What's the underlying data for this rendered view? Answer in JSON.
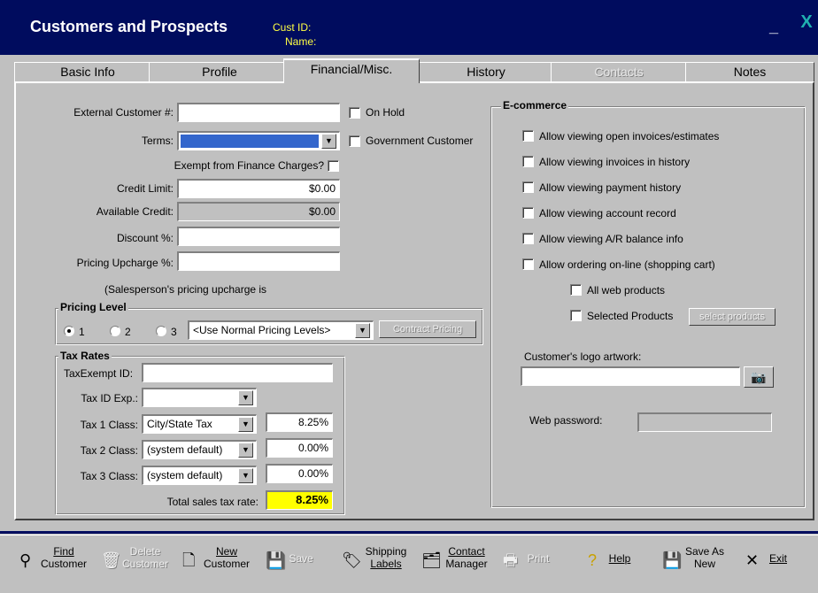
{
  "window": {
    "title": "Customers and Prospects",
    "cust_id_label": "Cust ID:",
    "name_label": "Name:",
    "minimize": "_",
    "close": "X"
  },
  "tabs": [
    {
      "label": "Basic Info",
      "state": "normal"
    },
    {
      "label": "Profile",
      "state": "normal"
    },
    {
      "label": "Financial/Misc.",
      "state": "active"
    },
    {
      "label": "History",
      "state": "normal"
    },
    {
      "label": "Contacts",
      "state": "disabled"
    },
    {
      "label": "Notes",
      "state": "normal"
    }
  ],
  "financial": {
    "external_customer_label": "External Customer #:",
    "external_customer_value": "",
    "on_hold_label": "On Hold",
    "terms_label": "Terms:",
    "terms_value": "",
    "government_label": "Government Customer",
    "exempt_label": "Exempt from Finance Charges?",
    "credit_limit_label": "Credit Limit:",
    "credit_limit_value": "$0.00",
    "available_credit_label": "Available Credit:",
    "available_credit_value": "$0.00",
    "discount_label": "Discount %:",
    "discount_value": "",
    "pricing_upcharge_label": "Pricing Upcharge %:",
    "pricing_upcharge_value": "",
    "salesperson_note": "(Salesperson's pricing upcharge is"
  },
  "pricing_level": {
    "title": "Pricing Level",
    "options": [
      "1",
      "2",
      "3"
    ],
    "selected": "1",
    "dropdown_value": "<Use Normal Pricing Levels>",
    "contract_button": "Contract Pricing"
  },
  "tax_rates": {
    "title": "Tax Rates",
    "tax_exempt_label": "TaxExempt ID:",
    "tax_exempt_value": "",
    "tax_id_exp_label": "Tax ID Exp.:",
    "tax_id_exp_value": "",
    "classes": [
      {
        "label": "Tax 1 Class:",
        "value": "City/State Tax",
        "rate": "8.25%"
      },
      {
        "label": "Tax 2 Class:",
        "value": "(system default)",
        "rate": "0.00%"
      },
      {
        "label": "Tax 3 Class:",
        "value": "(system default)",
        "rate": "0.00%"
      }
    ],
    "total_label": "Total sales tax rate:",
    "total_value": "8.25%"
  },
  "ecommerce": {
    "title": "E-commerce",
    "options": [
      "Allow viewing open invoices/estimates",
      "Allow viewing invoices in history",
      "Allow viewing payment history",
      "Allow viewing account record",
      "Allow viewing A/R balance info",
      "Allow ordering on-line (shopping cart)"
    ],
    "all_web_products": "All web products",
    "selected_products": "Selected Products",
    "select_products_button": "select products",
    "logo_label": "Customer's logo artwork:",
    "logo_value": "",
    "web_password_label": "Web password:",
    "web_password_value": ""
  },
  "toolbar": {
    "find": [
      "Find",
      "Customer"
    ],
    "delete": [
      "Delete",
      "Customer"
    ],
    "new": [
      "New",
      "Customer"
    ],
    "save": "Save",
    "shipping": [
      "Shipping",
      "Labels"
    ],
    "contact": [
      "Contact",
      "Manager"
    ],
    "print": "Print",
    "help": "Help",
    "save_as": [
      "Save As",
      "New"
    ],
    "exit": "Exit"
  },
  "colors": {
    "title_bar": "#000c5e",
    "title_label": "#ffff44",
    "highlight_total": "#ffff00",
    "terms_selected": "#3366cc"
  }
}
